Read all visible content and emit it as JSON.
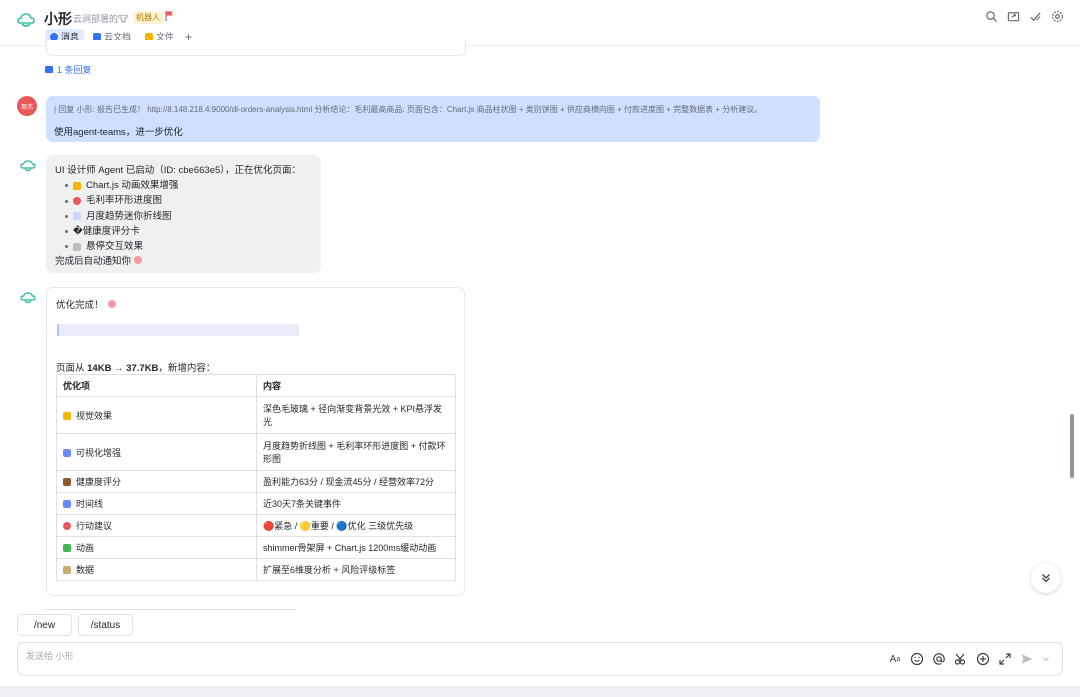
{
  "header": {
    "title": "小形",
    "subtitle": "云涧部署的🐮",
    "bot_badge": "机器人",
    "tabs": [
      {
        "label": "消息",
        "active": true,
        "icon": "message-icon",
        "color": "#3370ff"
      },
      {
        "label": "云文档",
        "active": false,
        "icon": "doc-icon",
        "color": "#3370ff"
      },
      {
        "label": "文件",
        "active": false,
        "icon": "folder-icon",
        "color": "#f5b400"
      }
    ],
    "add_tab": "+",
    "actions": [
      "search-icon",
      "share-icon",
      "check-icon",
      "settings-icon"
    ]
  },
  "thread": {
    "reply_link": "1 条回复"
  },
  "messages": {
    "user": {
      "avatar_text": "邢杰",
      "quote": "| 回复 小形: 报告已生成！ http://8.148.218.4:9000/dl-orders-analysis.html 分析结论：毛利最高商品: 页面包含：Chart.js 商品柱状图 + 类别饼图 + 供应商横向图 + 付款进度图 + 完整数据表 + 分析建议。",
      "text": "使用agent-teams，进一步优化"
    },
    "bot1": {
      "intro": "UI 设计师 Agent 已启动（ID: cbe663e5），正在优化页面：",
      "items": [
        {
          "emoji": "sparkles-icon",
          "color": "#f5b400",
          "text": "Chart.js 动画效果增强"
        },
        {
          "emoji": "target-icon",
          "color": "#e8585b",
          "text": "毛利率环形进度图"
        },
        {
          "emoji": "chart-icon",
          "color": "#6b8cff",
          "text": "月度趋势迷你折线图"
        },
        {
          "emoji": "",
          "color": "",
          "text": "�健康度评分卡"
        },
        {
          "emoji": "wrench-icon",
          "color": "#8f959e",
          "text": "悬停交互效果"
        }
      ],
      "footer": "完成后自动通知你"
    },
    "bot2": {
      "done": "优化完成！",
      "size_prefix": "页面从 ",
      "size_bold": "14KB → 37.7KB",
      "size_suffix": "，新增内容：",
      "table": {
        "headers": [
          "优化项",
          "内容"
        ],
        "rows": [
          {
            "icon": "sparkles-icon",
            "color": "#f5b400",
            "item": "视觉效果",
            "content": "深色毛玻璃 + 径向渐变背景光效 + KPI悬浮发光"
          },
          {
            "icon": "bar-chart-icon",
            "color": "#6b8cff",
            "item": "可视化增强",
            "content": "月度趋势折线图 + 毛利率环形进度图 + 付款环形图"
          },
          {
            "icon": "briefcase-icon",
            "color": "#8b5a2b",
            "item": "健康度评分",
            "content": "盈利能力63分 / 现金流45分 / 经营效率72分"
          },
          {
            "icon": "calendar-icon",
            "color": "#6b8cff",
            "item": "时间线",
            "content": "近30天7条关键事件"
          },
          {
            "icon": "target-icon",
            "color": "#e8585b",
            "item": "行动建议",
            "content": "🔴紧急 / 🟡重要 / 🔵优化 三级优先级"
          },
          {
            "icon": "animation-icon",
            "color": "#3fb950",
            "item": "动画",
            "content": "shimmer骨架屏 + Chart.js 1200ms缓动动画"
          },
          {
            "icon": "clipboard-icon",
            "color": "#c9a96e",
            "item": "数据",
            "content": "扩展至6维度分析 + 风险评级标签"
          }
        ]
      }
    }
  },
  "quick_commands": [
    "/new",
    "/status"
  ],
  "composer": {
    "placeholder": "发送给 小形"
  }
}
